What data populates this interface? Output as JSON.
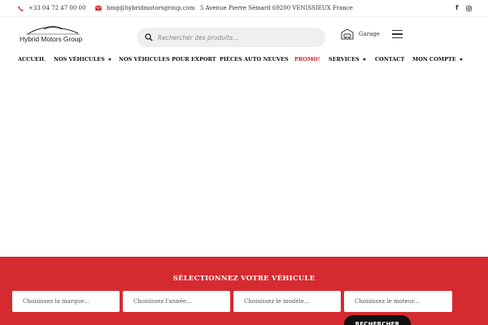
{
  "topbar": {
    "phone": "+33 04 72 47 00 00",
    "email": "hmg@hybridmotorsgroup.com",
    "address": "5 Avenue Pierre Sémard 69200 VENISSIEUX France",
    "social_facebook": "f"
  },
  "header": {
    "logo_text": "Hybrid Motors Group",
    "search_placeholder": "Rechercher des produits...",
    "garage_label": "Garage"
  },
  "nav": {
    "items": [
      {
        "label": "ACCUEIL"
      },
      {
        "label": "NOS VÉHICULES"
      },
      {
        "label": "NOS VÉHICULES POUR EXPORT"
      },
      {
        "label": "PIÈCES AUTO NEUVES"
      },
      {
        "label": "PROMO!"
      },
      {
        "label": "SERVICES"
      },
      {
        "label": "CONTACT"
      },
      {
        "label": "MON COMPTE"
      }
    ]
  },
  "vehicle_selector": {
    "title": "SÉLECTIONNEZ VOTRE VÉHICULE",
    "fields": [
      {
        "placeholder": "Choisissez la marque..."
      },
      {
        "placeholder": "Choisissez l'année..."
      },
      {
        "placeholder": "Choisissez le modèle..."
      },
      {
        "placeholder": "Choisissez le moteur..."
      }
    ],
    "search_button": "RECHERCHER"
  },
  "colors": {
    "accent_red": "#d52a30",
    "promo_red": "#d1232a",
    "button_black": "#111111"
  }
}
